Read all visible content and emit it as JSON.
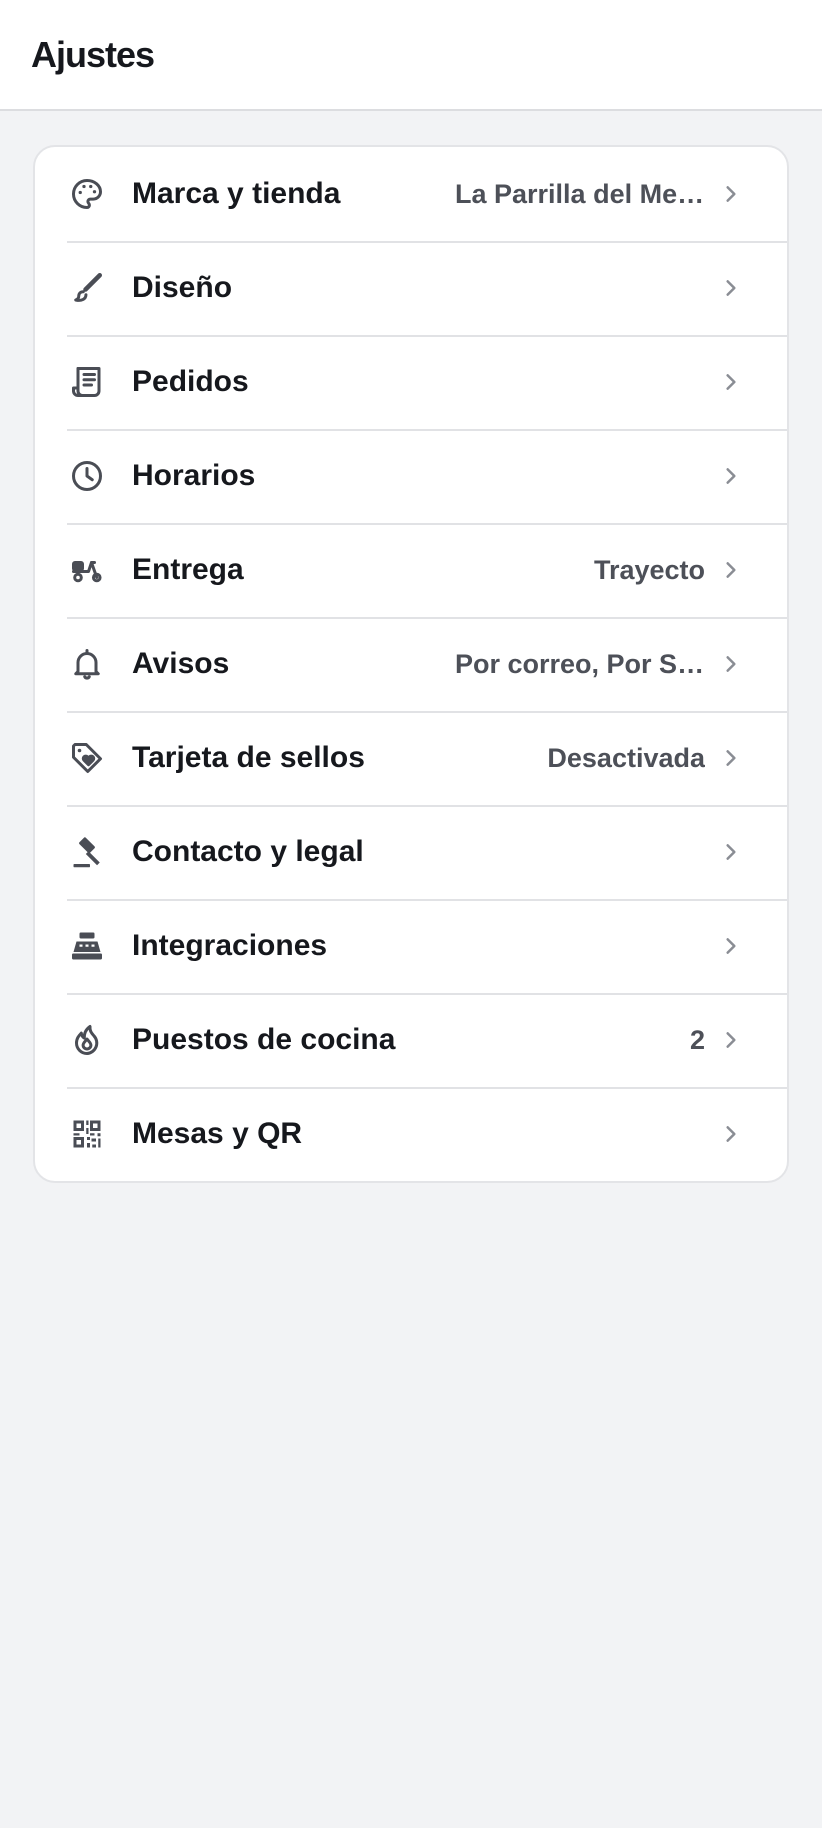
{
  "header": {
    "title": "Ajustes"
  },
  "colors": {
    "icon": "#4a4d55",
    "chevron": "#8a8d94",
    "value": "#4d5058"
  },
  "settings": [
    {
      "id": "brand",
      "icon": "palette-icon",
      "label": "Marca y tienda",
      "value": "La Parrilla del Merc…"
    },
    {
      "id": "design",
      "icon": "brush-icon",
      "label": "Diseño",
      "value": ""
    },
    {
      "id": "orders",
      "icon": "receipt-icon",
      "label": "Pedidos",
      "value": ""
    },
    {
      "id": "hours",
      "icon": "clock-icon",
      "label": "Horarios",
      "value": ""
    },
    {
      "id": "delivery",
      "icon": "scooter-icon",
      "label": "Entrega",
      "value": "Trayecto"
    },
    {
      "id": "notifications",
      "icon": "bell-icon",
      "label": "Avisos",
      "value": "Por correo, Por SMS"
    },
    {
      "id": "stamp-card",
      "icon": "tag-heart-icon",
      "label": "Tarjeta de sellos",
      "value": "Desactivada"
    },
    {
      "id": "contact-legal",
      "icon": "gavel-icon",
      "label": "Contacto y legal",
      "value": ""
    },
    {
      "id": "integrations",
      "icon": "cash-register-icon",
      "label": "Integraciones",
      "value": ""
    },
    {
      "id": "kitchen-stations",
      "icon": "flame-icon",
      "label": "Puestos de cocina",
      "value": "2"
    },
    {
      "id": "tables-qr",
      "icon": "qr-code-icon",
      "label": "Mesas y QR",
      "value": ""
    }
  ]
}
